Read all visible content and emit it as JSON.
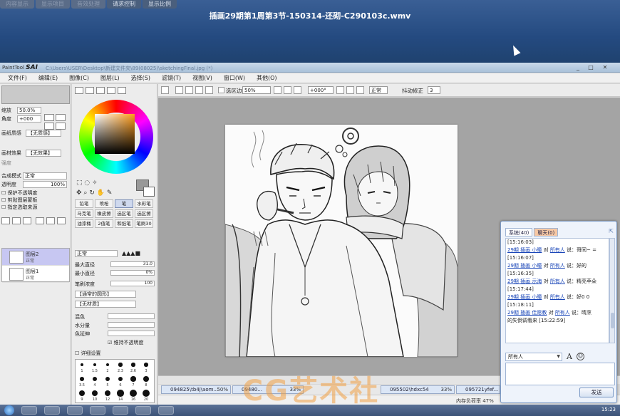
{
  "player": {
    "tabs": [
      "内容显示",
      "显示项目",
      "音效处理",
      "请求控制",
      "显示比例"
    ],
    "title": "插画29期第1周第3节-150314-还砌-C290103c.wmv"
  },
  "sai": {
    "logo_small": "PaintTool",
    "logo": "SAI",
    "path": "C:\\Users\\USER\\Desktop\\新建文件夹\\89(08025)\\sketchingFinal.jpg (*)",
    "menu": [
      "文件(F)",
      "编辑(E)",
      "图像(C)",
      "图层(L)",
      "选择(S)",
      "滤镜(T)",
      "视图(V)",
      "窗口(W)",
      "其他(O)"
    ],
    "toolbar": {
      "selection_edge": "选区边缘",
      "zoom": "50%",
      "rotation": "+000°",
      "mode": "正常",
      "stabilizer_label": "抖动修正",
      "stabilizer": "3"
    },
    "left": {
      "zoom_label": "缩放",
      "zoom_value": "50.0%",
      "angle_label": "角度",
      "angle_value": "+000",
      "paper_texture_label": "画纸质感",
      "paper_texture_value": "【无质感】",
      "paper_effect_label": "画材效果",
      "paper_effect_value": "【无效果】",
      "strength_label": "强度",
      "blend_label": "合成模式",
      "blend_value": "正常",
      "opacity_label": "透明度",
      "opacity_value": "100%",
      "checks": [
        "保护不透明度",
        "剪贴图层蒙板",
        "指定选取来源"
      ],
      "layers": [
        {
          "name": "图层2",
          "mode": "正常",
          "opacity": "100%"
        },
        {
          "name": "图层1",
          "mode": "正常",
          "opacity": "100%"
        }
      ]
    },
    "tools": {
      "grid": [
        "铅笔",
        "喷枪",
        "笔",
        "水彩笔",
        "马克笔",
        "橡皮擦",
        "选区笔",
        "选区擦",
        "油漆桶",
        "2值笔",
        "和纸笔",
        "笔刷30"
      ],
      "blend_mode": "正常",
      "max_size_label": "最大直径",
      "max_size_value": "31.0",
      "min_size_label": "最小直径",
      "min_size_value": "0%",
      "density_label": "笔刷浓度",
      "density_value": "100",
      "shape_value": "【通常的圆形】",
      "texture_value": "【无材质】",
      "blend_label": "混色",
      "water_label": "水分量",
      "extend_label": "色延伸",
      "keep_opacity": "维持不透明度",
      "detail_label": "详细设置",
      "sizes": [
        "1",
        "1.5",
        "2",
        "2.3",
        "2.6",
        "3",
        "3.5",
        "4",
        "5",
        "6",
        "7",
        "8",
        "9",
        "10",
        "12",
        "14",
        "16",
        "20",
        "25",
        "30",
        "35",
        "40",
        "50",
        "60"
      ]
    },
    "view_tabs": [
      {
        "name": "094825\\tb4j\\aom...",
        "pct": "50%"
      },
      {
        "name": "09480...",
        "pct": "33%"
      },
      {
        "name": "095502\\hdxc54",
        "pct": "33%"
      },
      {
        "name": "095721yfef...",
        "pct": "33%"
      }
    ],
    "status": "内存负荷率 47%"
  },
  "chat": {
    "tabs": [
      "系统(40)",
      "聊天(0)"
    ],
    "messages": [
      {
        "time": "[15:16:03]",
        "user": "29期 插画 小瞳",
        "to": "所有人",
        "text": "说：哥同~ ="
      },
      {
        "time": "[15:16:07]",
        "user": "29期 插画 小瞳",
        "to": "所有人",
        "text": "说：好的"
      },
      {
        "time": "[15:16:35]",
        "user": "29期 插画 示海",
        "to": "所有人",
        "text": "说：精亮苹朵"
      },
      {
        "time": "[15:17:44]",
        "user": "29期 插画 小瞳",
        "to": "所有人",
        "text": "说：好0 0"
      },
      {
        "time": "[15:18:11]",
        "user": "29期 插画 佳愿教",
        "to": "所有人",
        "text": "说：晴烹"
      },
      {
        "time": "",
        "user": "",
        "to": "",
        "text": "的失倒调看来 [15:22:59]"
      }
    ],
    "recipient": "所有人",
    "font_button": "A",
    "send_label": "发送"
  },
  "watermark": "CG艺术社",
  "taskbar": {
    "clock": "15:23"
  }
}
